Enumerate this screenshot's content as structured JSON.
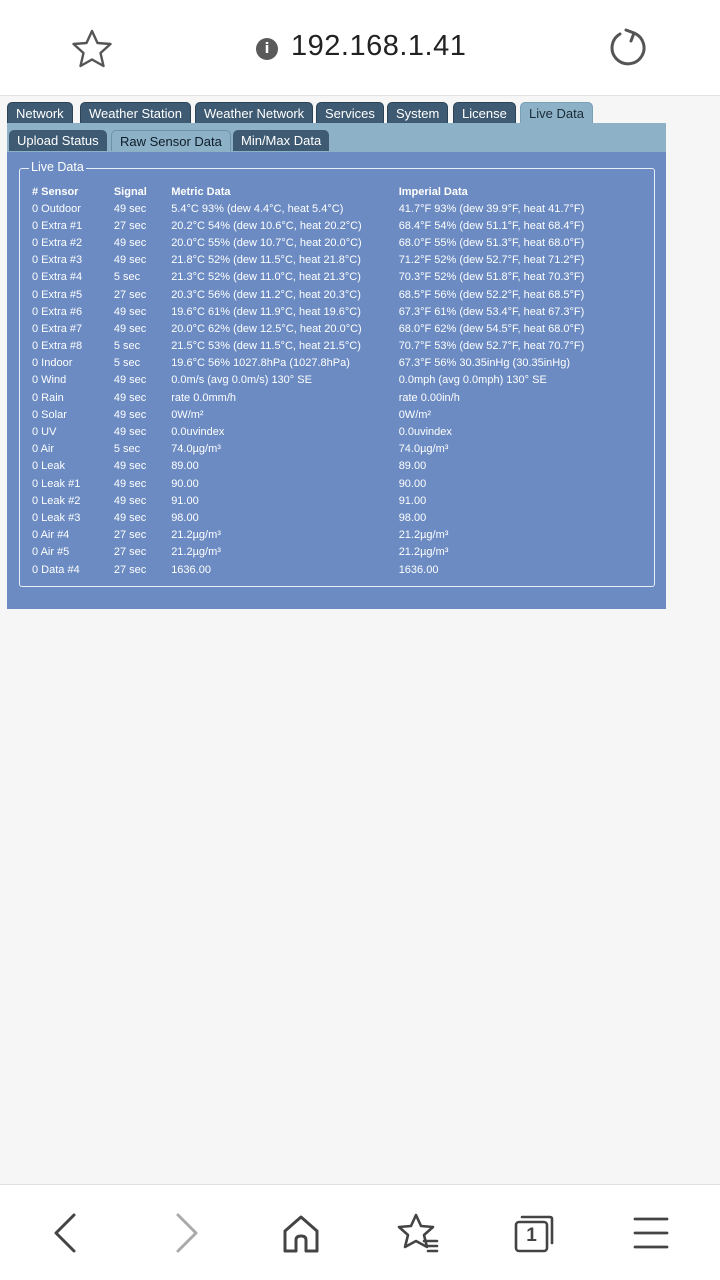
{
  "browser": {
    "url": "192.168.1.41",
    "info_glyph": "i",
    "tab_count": "1"
  },
  "tabs": [
    {
      "label": "Network"
    },
    {
      "label": "Weather Station"
    },
    {
      "label": "Weather Network"
    },
    {
      "label": "Services"
    },
    {
      "label": "System"
    },
    {
      "label": "License"
    },
    {
      "label": "Live Data"
    }
  ],
  "subtabs": [
    {
      "label": "Upload Status"
    },
    {
      "label": "Raw Sensor Data"
    },
    {
      "label": "Min/Max Data"
    }
  ],
  "panel": {
    "legend": "Live Data",
    "headers": [
      "# Sensor",
      "Signal",
      "Metric Data",
      "Imperial Data"
    ],
    "rows": [
      [
        "0 Outdoor",
        "49 sec",
        "5.4°C 93% (dew 4.4°C, heat 5.4°C)",
        "41.7°F 93% (dew 39.9°F, heat 41.7°F)"
      ],
      [
        "0 Extra #1",
        "27 sec",
        "20.2°C 54% (dew 10.6°C, heat 20.2°C)",
        "68.4°F 54% (dew 51.1°F, heat 68.4°F)"
      ],
      [
        "0 Extra #2",
        "49 sec",
        "20.0°C 55% (dew 10.7°C, heat 20.0°C)",
        "68.0°F 55% (dew 51.3°F, heat 68.0°F)"
      ],
      [
        "0 Extra #3",
        "49 sec",
        "21.8°C 52% (dew 11.5°C, heat 21.8°C)",
        "71.2°F 52% (dew 52.7°F, heat 71.2°F)"
      ],
      [
        "0 Extra #4",
        "5 sec",
        "21.3°C 52% (dew 11.0°C, heat 21.3°C)",
        "70.3°F 52% (dew 51.8°F, heat 70.3°F)"
      ],
      [
        "0 Extra #5",
        "27 sec",
        "20.3°C 56% (dew 11.2°C, heat 20.3°C)",
        "68.5°F 56% (dew 52.2°F, heat 68.5°F)"
      ],
      [
        "0 Extra #6",
        "49 sec",
        "19.6°C 61% (dew 11.9°C, heat 19.6°C)",
        "67.3°F 61% (dew 53.4°F, heat 67.3°F)"
      ],
      [
        "0 Extra #7",
        "49 sec",
        "20.0°C 62% (dew 12.5°C, heat 20.0°C)",
        "68.0°F 62% (dew 54.5°F, heat 68.0°F)"
      ],
      [
        "0 Extra #8",
        "5 sec",
        "21.5°C 53% (dew 11.5°C, heat 21.5°C)",
        "70.7°F 53% (dew 52.7°F, heat 70.7°F)"
      ],
      [
        "0 Indoor",
        "5 sec",
        "19.6°C 56% 1027.8hPa (1027.8hPa)",
        "67.3°F 56% 30.35inHg (30.35inHg)"
      ],
      [
        "0 Wind",
        "49 sec",
        "0.0m/s (avg 0.0m/s) 130° SE",
        "0.0mph (avg 0.0mph) 130° SE"
      ],
      [
        "0 Rain",
        "49 sec",
        "rate 0.0mm/h",
        "rate 0.00in/h"
      ],
      [
        "0 Solar",
        "49 sec",
        "0W/m²",
        "0W/m²"
      ],
      [
        "0 UV",
        "49 sec",
        "0.0uvindex",
        "0.0uvindex"
      ],
      [
        "0 Air",
        "5 sec",
        "74.0µg/m³",
        "74.0µg/m³"
      ],
      [
        "0 Leak",
        "49 sec",
        "89.00",
        "89.00"
      ],
      [
        "0 Leak #1",
        "49 sec",
        "90.00",
        "90.00"
      ],
      [
        "0 Leak #2",
        "49 sec",
        "91.00",
        "91.00"
      ],
      [
        "0 Leak #3",
        "49 sec",
        "98.00",
        "98.00"
      ],
      [
        "0 Air #4",
        "27 sec",
        "21.2µg/m³",
        "21.2µg/m³"
      ],
      [
        "0 Air #5",
        "27 sec",
        "21.2µg/m³",
        "21.2µg/m³"
      ],
      [
        "0 Data #4",
        "27 sec",
        "1636.00",
        "1636.00"
      ]
    ]
  },
  "colors": {
    "tab_inactive": "#3f5b73",
    "tab_active": "#8db1c6",
    "panel_bg": "#6b8bc2"
  },
  "icons": {
    "top": [
      "star-icon",
      "info-icon",
      "reload-icon"
    ],
    "bottom": [
      "back-arrow-icon",
      "forward-arrow-icon",
      "home-icon",
      "bookmarks-icon",
      "tabs-icon",
      "menu-icon"
    ]
  }
}
